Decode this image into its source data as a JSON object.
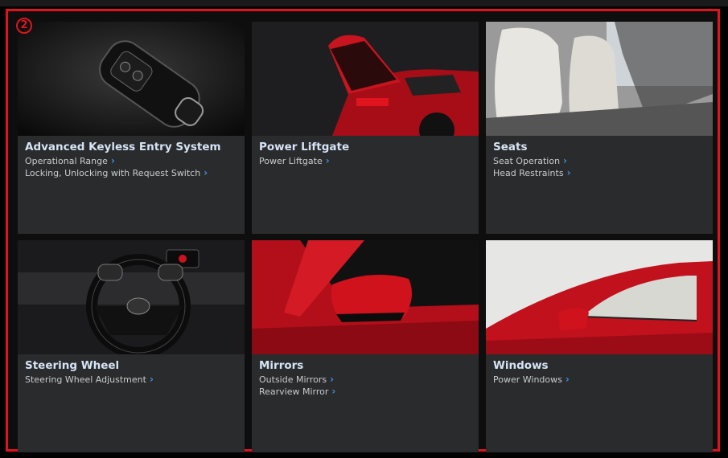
{
  "marker": "2",
  "cards": [
    {
      "title": "Advanced Keyless Entry System",
      "links": [
        "Operational Range",
        "Locking, Unlocking with Request Switch"
      ]
    },
    {
      "title": "Power Liftgate",
      "links": [
        "Power Liftgate"
      ]
    },
    {
      "title": "Seats",
      "links": [
        "Seat Operation",
        "Head Restraints"
      ]
    },
    {
      "title": "Steering Wheel",
      "links": [
        "Steering Wheel Adjustment"
      ]
    },
    {
      "title": "Mirrors",
      "links": [
        "Outside Mirrors",
        "Rearview Mirror"
      ]
    },
    {
      "title": "Windows",
      "links": [
        "Power Windows"
      ]
    }
  ],
  "colors": {
    "highlight": "#e0141e",
    "card": "#2a2b2d",
    "title": "#d6e4f5",
    "chevron": "#3d8fe0"
  },
  "icons": {
    "chevron": "chevron-right-icon"
  }
}
